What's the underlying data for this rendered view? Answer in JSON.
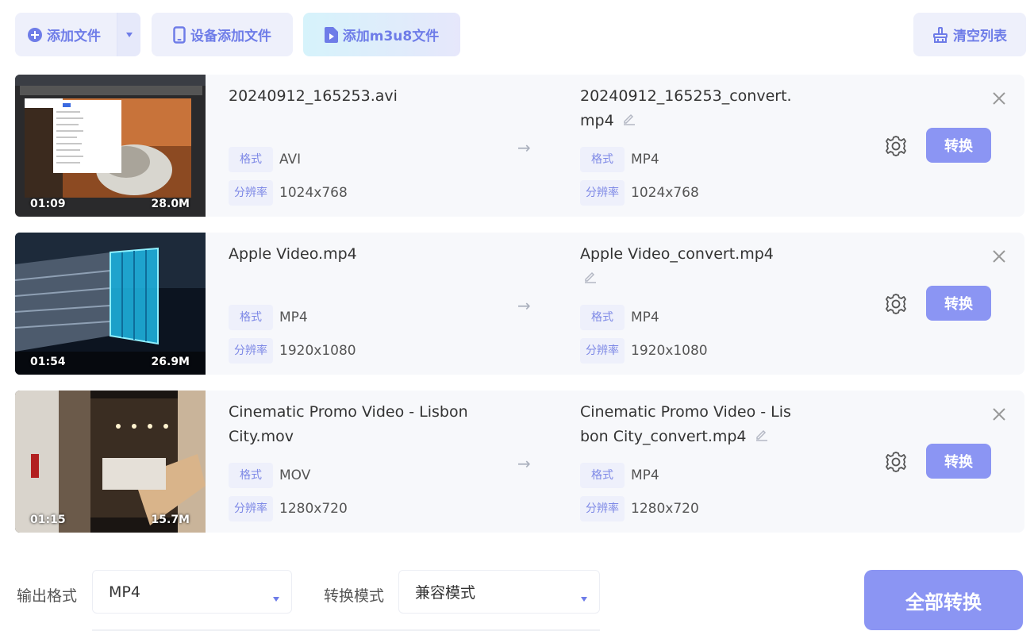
{
  "toolbar": {
    "add_file": "添加文件",
    "device_add": "设备添加文件",
    "add_m3u8": "添加m3u8文件",
    "clear_list": "清空列表"
  },
  "files": [
    {
      "duration": "01:09",
      "size": "28.0M",
      "src_name": "20240912_165253.avi",
      "src_format": "AVI",
      "src_resolution": "1024x768",
      "dst_name": "20240912_165253_convert.mp4",
      "dst_format": "MP4",
      "dst_resolution": "1024x768"
    },
    {
      "duration": "01:54",
      "size": "26.9M",
      "src_name": "Apple Video.mp4",
      "src_format": "MP4",
      "src_resolution": "1920x1080",
      "dst_name": "Apple Video_convert.mp4",
      "dst_format": "MP4",
      "dst_resolution": "1920x1080"
    },
    {
      "duration": "01:15",
      "size": "15.7M",
      "src_name": "Cinematic Promo Video - Lisbon City.mov",
      "src_format": "MOV",
      "src_resolution": "1280x720",
      "dst_name": "Cinematic Promo Video - Lisbon City_convert.mp4",
      "dst_format": "MP4",
      "dst_resolution": "1280x720"
    }
  ],
  "labels": {
    "format": "格式",
    "resolution": "分辨率",
    "arrow": "→",
    "convert": "转换"
  },
  "bottom": {
    "output_format_label": "输出格式",
    "output_format_value": "MP4",
    "mode_label": "转换模式",
    "mode_value": "兼容模式",
    "convert_all": "全部转换"
  },
  "colors": {
    "accent": "#8b95f3",
    "accent_text": "#6e7ce8",
    "tag_bg": "#eef0fb",
    "row_bg": "#f7f8fb"
  }
}
